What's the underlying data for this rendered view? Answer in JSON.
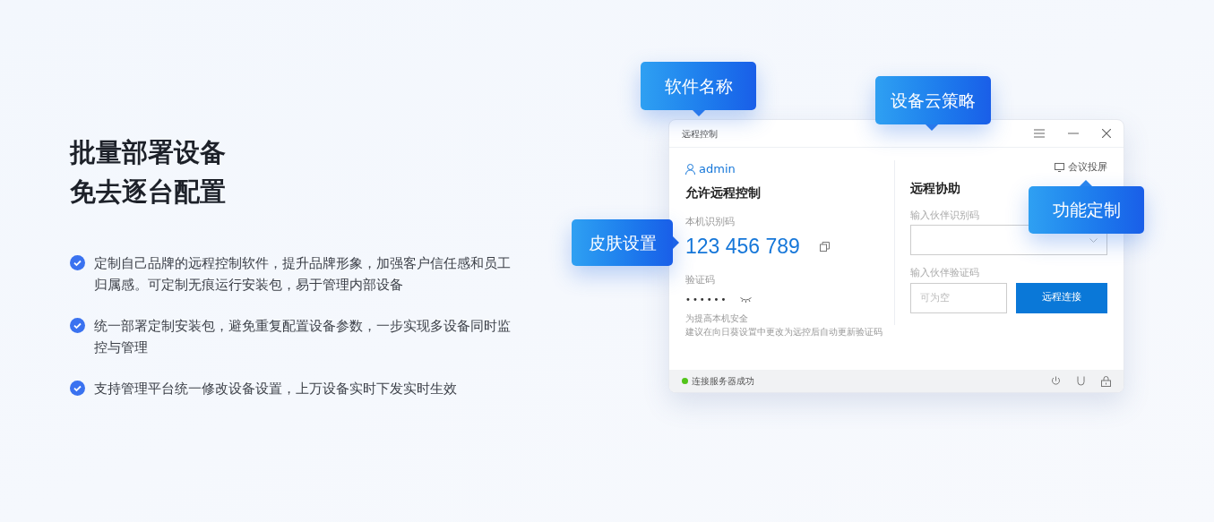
{
  "headline": [
    "批量部署设备",
    "免去逐台配置"
  ],
  "features": [
    "定制自己品牌的远程控制软件，提升品牌形象，加强客户信任感和员工归属感。可定制无痕运行安装包，易于管理内部设备",
    "统一部署定制安装包，避免重复配置设备参数，一步实现多设备同时监控与管理",
    "支持管理平台统一修改设备设置，上万设备实时下发实时生效"
  ],
  "window": {
    "title": "远程控制",
    "user": "admin",
    "meeting_button": "会议投屏",
    "left": {
      "heading": "允许远程控制",
      "id_label": "本机识别码",
      "id_value": "123 456 789",
      "code_label": "验证码",
      "code_value": "••••••",
      "hint": [
        "为提高本机安全",
        "建议在向日葵设置中更改为远控后自动更新验证码"
      ]
    },
    "right": {
      "heading": "远程协助",
      "partner_id_label": "输入伙伴识别码",
      "partner_code_label": "输入伙伴验证码",
      "partner_code_placeholder": "可为空",
      "connect_button": "远程连接"
    },
    "status_bar": {
      "text": "连接服务器成功",
      "color": "#52c41a"
    }
  },
  "callouts": [
    {
      "label": "软件名称"
    },
    {
      "label": "设备云策略"
    },
    {
      "label": "皮肤设置"
    },
    {
      "label": "功能定制"
    }
  ]
}
